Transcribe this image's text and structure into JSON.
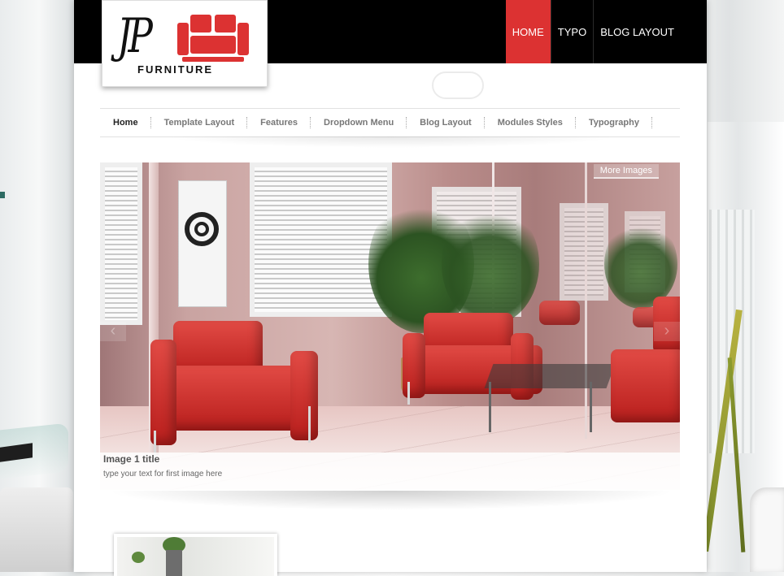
{
  "logo": {
    "letters": "JP",
    "wordmark": "FURNITURE",
    "colors": {
      "sofa": "#dc3232",
      "text": "#111111"
    }
  },
  "top_nav": [
    {
      "label": "HOME",
      "active": true
    },
    {
      "label": "TYPO",
      "active": false
    },
    {
      "label": "BLOG LAYOUT",
      "active": false
    }
  ],
  "main_menu": [
    {
      "label": "Home",
      "current": true
    },
    {
      "label": "Template Layout",
      "current": false
    },
    {
      "label": "Features",
      "current": false
    },
    {
      "label": "Dropdown Menu",
      "current": false
    },
    {
      "label": "Blog Layout",
      "current": false
    },
    {
      "label": "Modules Styles",
      "current": false
    },
    {
      "label": "Typography",
      "current": false
    }
  ],
  "slideshow": {
    "more_images": "More Images",
    "caption_title": "Image 1 title",
    "caption_text": "type your text for first image here",
    "prev_icon": "chevron-left-icon",
    "next_icon": "chevron-right-icon"
  },
  "colors": {
    "accent": "#dc3232",
    "topbar": "#000000",
    "page": "#ffffff"
  }
}
